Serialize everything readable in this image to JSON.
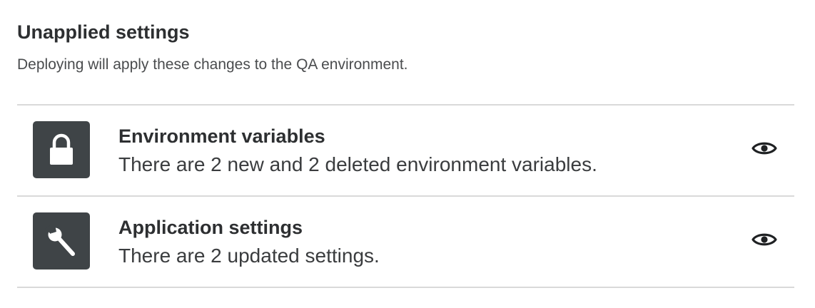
{
  "header": {
    "title": "Unapplied settings",
    "subtitle": "Deploying will apply these changes to the QA environment."
  },
  "changes": [
    {
      "icon": "lock-icon",
      "title": "Environment variables",
      "description": "There are 2 new and 2 deleted environment variables.",
      "action_icon": "eye-icon"
    },
    {
      "icon": "wrench-icon",
      "title": "Application settings",
      "description": "There are 2 updated settings.",
      "action_icon": "eye-icon"
    }
  ],
  "colors": {
    "icon_background": "#3f4447",
    "divider": "#d9d9d9",
    "text_primary": "#2d2f31"
  }
}
